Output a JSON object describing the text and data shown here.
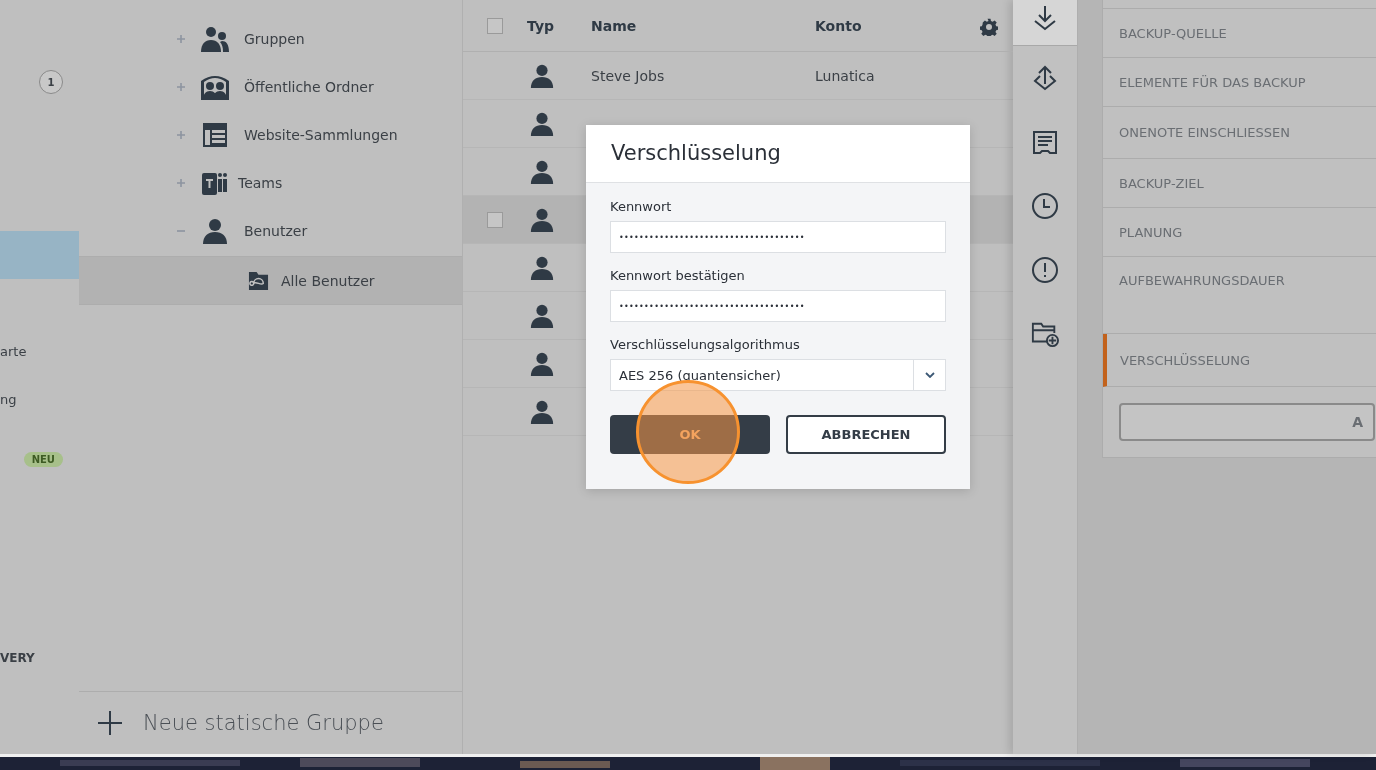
{
  "nav": {
    "items": [
      {
        "kind": "count",
        "badge": "1",
        "selected": false
      },
      {
        "kind": "blank",
        "selected": true
      },
      {
        "kind": "text",
        "label": "arte",
        "selected": false
      },
      {
        "kind": "text",
        "label": "ng",
        "selected": false
      },
      {
        "kind": "tag",
        "badge": "NEU",
        "selected": false
      }
    ],
    "section": "VERY"
  },
  "tree": {
    "items": [
      {
        "label": "Gruppen",
        "expanded": false,
        "selected": false
      },
      {
        "label": "Öffentliche Ordner",
        "expanded": false,
        "selected": false
      },
      {
        "label": "Website-Sammlungen",
        "expanded": false,
        "selected": false
      },
      {
        "label": "Teams",
        "expanded": false,
        "selected": false
      },
      {
        "label": "Benutzer",
        "expanded": true,
        "selected": false,
        "children": [
          {
            "label": "Alle Benutzer",
            "selected": true
          }
        ]
      }
    ],
    "add_button": "Neue statische Gruppe"
  },
  "table": {
    "columns": [
      "Typ",
      "Name",
      "Konto"
    ],
    "select_all_checked": false,
    "rows": [
      {
        "name": "Steve Jobs",
        "account": "Lunatica",
        "highlighted": false,
        "checked": false
      },
      {
        "highlighted": false,
        "checked": false
      },
      {
        "highlighted": false,
        "checked": false
      },
      {
        "highlighted": true,
        "checked": false
      },
      {
        "highlighted": false,
        "checked": false
      },
      {
        "highlighted": false,
        "checked": false
      },
      {
        "highlighted": false,
        "checked": false
      },
      {
        "highlighted": false,
        "checked": false
      }
    ]
  },
  "rail": {
    "items": [
      {
        "selected": true
      },
      {
        "selected": false
      },
      {
        "selected": false
      },
      {
        "selected": false
      },
      {
        "selected": false
      },
      {
        "selected": false
      }
    ]
  },
  "steps": {
    "items": [
      {
        "label": "BACKUP-QUELLE",
        "selected": false
      },
      {
        "label": "ELEMENTE FÜR DAS BACKUP",
        "selected": false
      },
      {
        "label": "ONENOTE EINSCHLIESSEN",
        "selected": false
      },
      {
        "label": "BACKUP-ZIEL",
        "selected": false
      },
      {
        "label": "PLANUNG",
        "selected": false
      },
      {
        "label": "AUFBEWAHRUNGSDAUER",
        "selected": false
      },
      {
        "label": "VERSCHLÜSSELUNG",
        "selected": true
      }
    ],
    "button": "A"
  },
  "dialog": {
    "title": "Verschlüsselung",
    "fields": [
      {
        "kind": "password",
        "label": "Kennwort",
        "value": "•••••••••••••••••••••••••••••••••••••"
      },
      {
        "kind": "password",
        "label": "Kennwort bestätigen",
        "value": "•••••••••••••••••••••••••••••••••••••"
      },
      {
        "kind": "select",
        "label": "Verschlüsselungsalgorithmus",
        "value": "AES 256 (quantensicher)"
      }
    ],
    "buttons": [
      {
        "kind": "primary",
        "label": "OK",
        "highlighted": true
      },
      {
        "kind": "secondary",
        "label": "ABBRECHEN",
        "highlighted": false
      }
    ]
  }
}
